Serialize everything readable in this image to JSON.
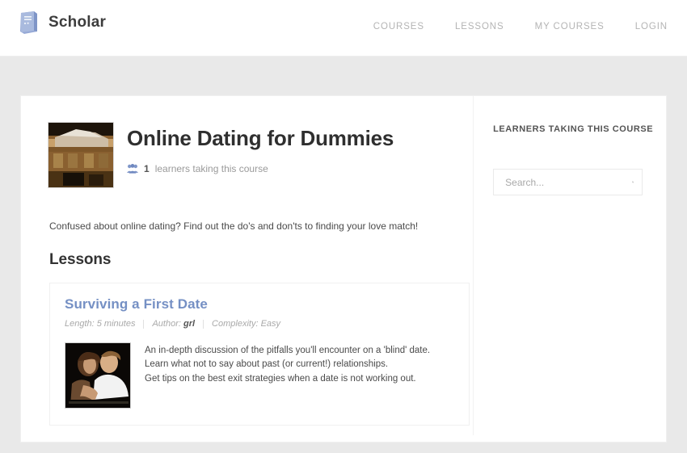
{
  "header": {
    "logo_icon": "book-icon",
    "brand": "Scholar",
    "nav": [
      {
        "label": "COURSES"
      },
      {
        "label": "LESSONS"
      },
      {
        "label": "MY COURSES"
      },
      {
        "label": "LOGIN"
      }
    ]
  },
  "course": {
    "title": "Online Dating for Dummies",
    "thumbnail_alt": "course-thumbnail",
    "learners_icon": "people-icon",
    "learners_count": "1",
    "learners_label": "learners taking this course",
    "description": "Confused about online dating? Find out the do's and don'ts to finding  your love match!",
    "lessons_heading": "Lessons"
  },
  "lessons": [
    {
      "title": "Surviving a First Date",
      "length_label": "Length: 5 minutes",
      "author_label": "Author:",
      "author_name": "grl",
      "complexity_label": "Complexity: Easy",
      "thumbnail_alt": "lesson-thumbnail",
      "description_lines": [
        "An in-depth discussion of the pitfalls you'll encounter on a 'blind' date.",
        "Learn what not to say about past (or current!) relationships.",
        "Get tips on the best exit strategies when a date is not working out."
      ]
    }
  ],
  "sidebar": {
    "heading": "LEARNERS TAKING THIS COURSE",
    "search_placeholder": "Search...",
    "search_value": "",
    "search_icon": "search-icon"
  },
  "colors": {
    "brand_blue": "#8097c9",
    "lesson_title": "#7590c4",
    "page_bg": "#e9e9e9",
    "card_bg": "#ffffff",
    "nav_text": "#b4b4b4"
  }
}
